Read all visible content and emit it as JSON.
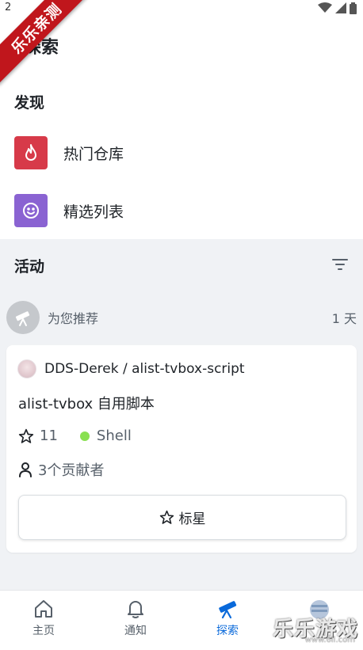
{
  "status_bar": {
    "time": "2"
  },
  "watermark": {
    "ribbon_text": "乐乐亲测",
    "brand_text": "乐乐游戏",
    "brand_url": "www.6ll.com"
  },
  "header": {
    "title": "探索"
  },
  "discover": {
    "section_title": "发现",
    "items": [
      {
        "label": "热门仓库",
        "icon": "flame-icon",
        "color": "#d73a49"
      },
      {
        "label": "精选列表",
        "icon": "smiley-icon",
        "color": "#8a63d2"
      }
    ]
  },
  "activity": {
    "section_title": "活动",
    "filter_icon": "filter-icon",
    "recommendation": {
      "label": "为您推荐",
      "time": "1 天",
      "icon": "telescope-icon"
    },
    "repo": {
      "full_name": "DDS-Derek / alist-tvbox-script",
      "description": "alist-tvbox 自用脚本",
      "stars": "11",
      "language": "Shell",
      "language_color": "#89e051",
      "contributors": "3个贡献者",
      "star_button_label": "标星"
    }
  },
  "bottom_nav": {
    "items": [
      {
        "label": "主页",
        "icon": "home-icon",
        "active": false
      },
      {
        "label": "通知",
        "icon": "bell-icon",
        "active": false
      },
      {
        "label": "探索",
        "icon": "telescope-icon",
        "active": true
      },
      {
        "label": "",
        "icon": "profile-icon",
        "active": false
      }
    ],
    "accent": "#0969da"
  }
}
